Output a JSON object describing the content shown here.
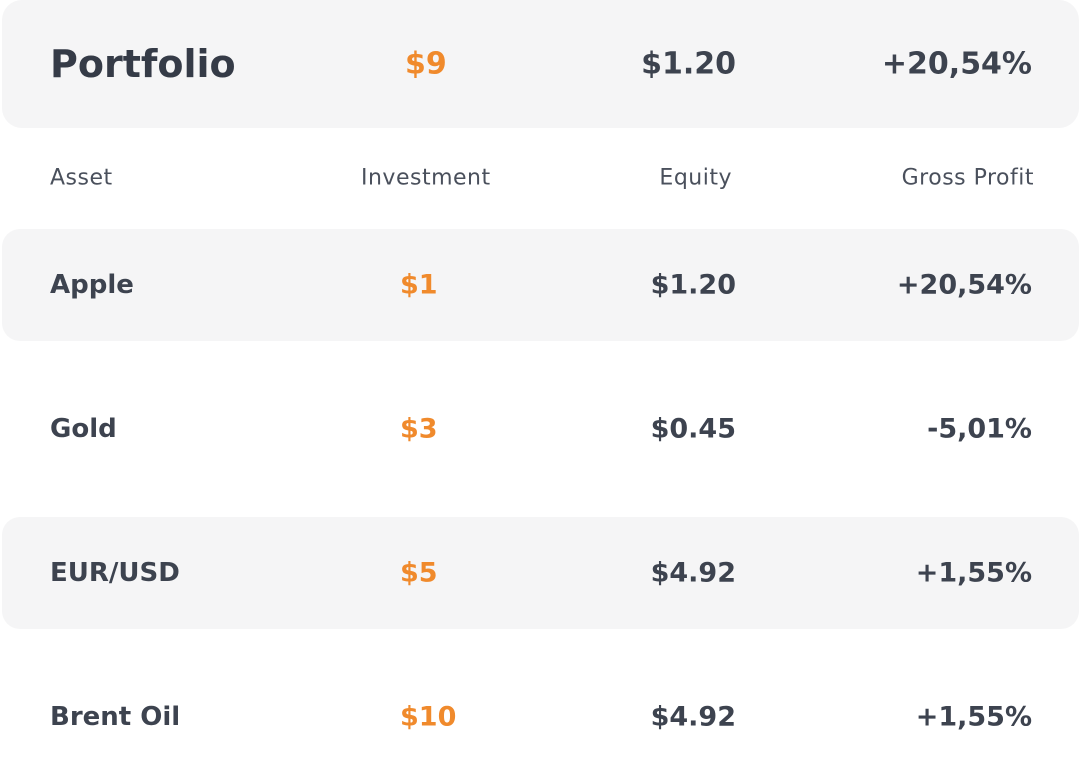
{
  "summary": {
    "title": "Portfolio",
    "investment": "$9",
    "equity": "$1.20",
    "gross_profit": "+20,54%"
  },
  "headers": {
    "asset": "Asset",
    "investment": "Investment",
    "equity": "Equity",
    "gross_profit": "Gross Profit"
  },
  "rows": [
    {
      "asset": "Apple",
      "investment": "$1",
      "equity": "$1.20",
      "gross_profit": "+20,54%",
      "shaded": true
    },
    {
      "asset": "Gold",
      "investment": "$3",
      "equity": "$0.45",
      "gross_profit": "-5,01%",
      "shaded": false
    },
    {
      "asset": "EUR/USD",
      "investment": "$5",
      "equity": "$4.92",
      "gross_profit": "+1,55%",
      "shaded": true
    },
    {
      "asset": "Brent Oil",
      "investment": "$10",
      "equity": "$4.92",
      "gross_profit": "+1,55%",
      "shaded": false
    }
  ],
  "colors": {
    "accent": "#f08a2c",
    "text": "#3d434f",
    "row_background": "#f5f5f6"
  }
}
